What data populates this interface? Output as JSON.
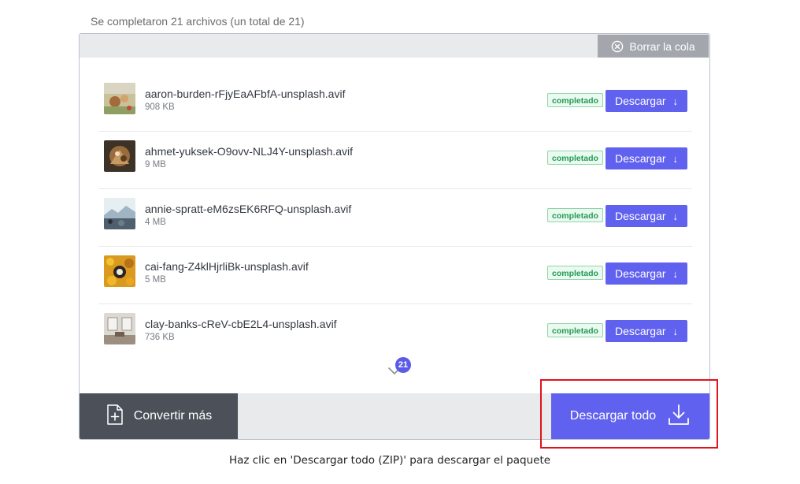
{
  "summary": "Se completaron 21 archivos (un total de 21)",
  "clear_queue": {
    "label": "Borrar la cola",
    "icon": "close-circle-icon"
  },
  "files": [
    {
      "name": "aaron-burden-rFjyEaAFbfA-unsplash.avif",
      "size": "908 KB",
      "status": "completado",
      "download_label": "Descargar",
      "download_icon": "↓"
    },
    {
      "name": "ahmet-yuksek-O9ovv-NLJ4Y-unsplash.avif",
      "size": "9 MB",
      "status": "completado",
      "download_label": "Descargar",
      "download_icon": "↓"
    },
    {
      "name": "annie-spratt-eM6zsEK6RFQ-unsplash.avif",
      "size": "4 MB",
      "status": "completado",
      "download_label": "Descargar",
      "download_icon": "↓"
    },
    {
      "name": "cai-fang-Z4klHjrliBk-unsplash.avif",
      "size": "5 MB",
      "status": "completado",
      "download_label": "Descargar",
      "download_icon": "↓"
    },
    {
      "name": "clay-banks-cReV-cbE2L4-unsplash.avif",
      "size": "736 KB",
      "status": "completado",
      "download_label": "Descargar",
      "download_icon": "↓"
    }
  ],
  "more_count": "21",
  "convert_more": {
    "label": "Convertir más",
    "icon": "file-plus-icon"
  },
  "download_all": {
    "label": "Descargar todo",
    "icon": "download-tray-icon"
  },
  "caption": "Haz clic en 'Descargar todo (ZIP)' para descargar el paquete",
  "colors": {
    "accent": "#6161ef",
    "completed_text": "#229a54",
    "completed_bg": "#eafaf0",
    "highlight": "#e0141c",
    "convert_bg": "#4b5059",
    "clear_bg": "#a3a7ad"
  }
}
